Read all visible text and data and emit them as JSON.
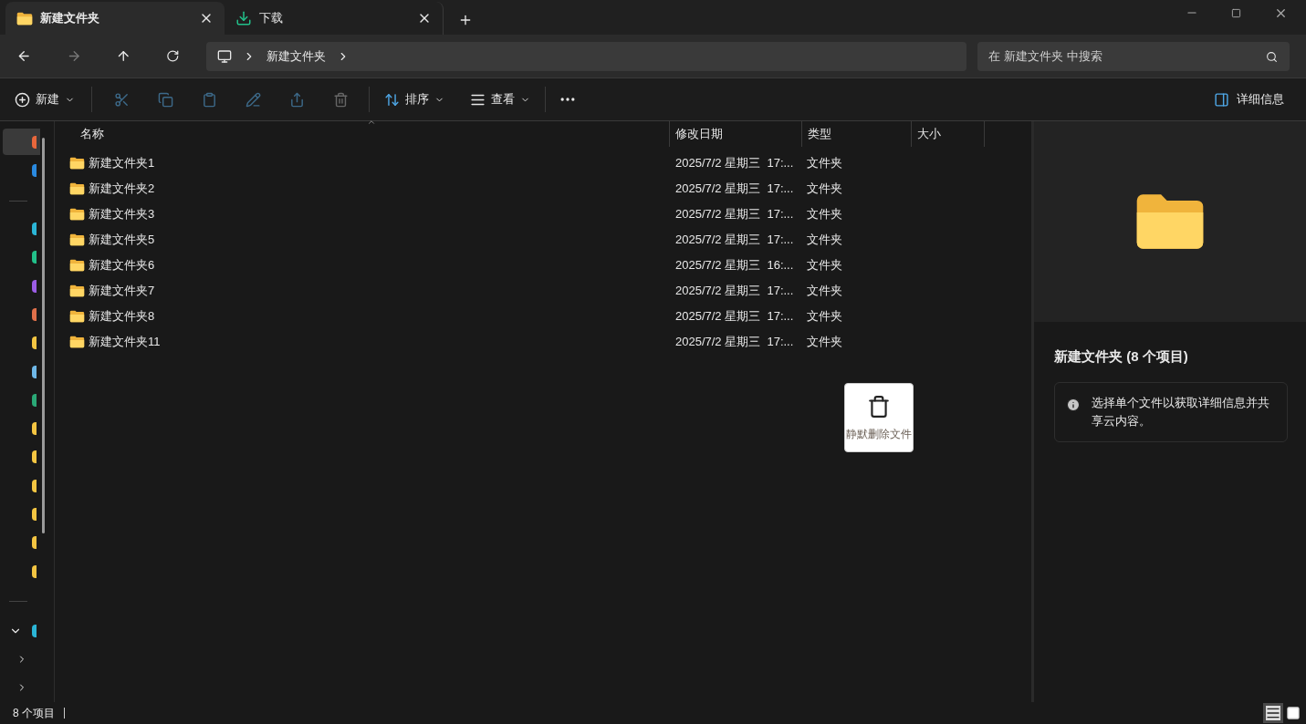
{
  "tabs": [
    {
      "label": "新建文件夹",
      "kind": "folder",
      "selected": true
    },
    {
      "label": "下载",
      "kind": "download",
      "selected": false
    }
  ],
  "address": {
    "crumbs": [
      "新建文件夹"
    ]
  },
  "search": {
    "placeholder": "在 新建文件夹 中搜索"
  },
  "toolbar": {
    "new_label": "新建",
    "sort_label": "排序",
    "view_label": "查看",
    "details_label": "详细信息"
  },
  "sidebar": {
    "items": [
      {
        "color": "#e8673c",
        "selected": true
      },
      {
        "color": "#2a8ae0",
        "selected": false
      },
      {
        "color": "#2bb5d6",
        "selected": false,
        "divider_before": true
      },
      {
        "color": "#22c08a",
        "selected": false
      },
      {
        "color": "#9b5de5",
        "selected": false
      },
      {
        "color": "#e0704a",
        "selected": false
      },
      {
        "color": "#f4c542",
        "selected": false
      },
      {
        "color": "#6fb8e8",
        "selected": false
      },
      {
        "color": "#2aa876",
        "selected": false
      },
      {
        "color": "#f4c542",
        "selected": false
      },
      {
        "color": "#f4c542",
        "selected": false
      },
      {
        "color": "#f4c542",
        "selected": false
      },
      {
        "color": "#f4c542",
        "selected": false
      },
      {
        "color": "#f4c542",
        "selected": false
      },
      {
        "color": "#f4c542",
        "selected": false
      }
    ],
    "tree": [
      {
        "expanded": true,
        "color": "#2bb5d6"
      },
      {
        "expanded": false
      },
      {
        "expanded": false
      }
    ]
  },
  "table": {
    "columns": [
      "名称",
      "修改日期",
      "类型",
      "大小"
    ],
    "rows": [
      {
        "name": "新建文件夹1",
        "modified": "2025/7/2 星期三  17:...",
        "type": "文件夹"
      },
      {
        "name": "新建文件夹2",
        "modified": "2025/7/2 星期三  17:...",
        "type": "文件夹"
      },
      {
        "name": "新建文件夹3",
        "modified": "2025/7/2 星期三  17:...",
        "type": "文件夹"
      },
      {
        "name": "新建文件夹5",
        "modified": "2025/7/2 星期三  17:...",
        "type": "文件夹"
      },
      {
        "name": "新建文件夹6",
        "modified": "2025/7/2 星期三  16:...",
        "type": "文件夹"
      },
      {
        "name": "新建文件夹7",
        "modified": "2025/7/2 星期三  17:...",
        "type": "文件夹"
      },
      {
        "name": "新建文件夹8",
        "modified": "2025/7/2 星期三  17:...",
        "type": "文件夹"
      },
      {
        "name": "新建文件夹11",
        "modified": "2025/7/2 星期三  17:...",
        "type": "文件夹"
      }
    ]
  },
  "tooltip": {
    "label": "静默删除文件"
  },
  "details": {
    "title": "新建文件夹 (8 个项目)",
    "info": "选择单个文件以获取详细信息并共享云内容。"
  },
  "status_bar": {
    "count": "8 个项目"
  },
  "view_modes": [
    {
      "kind": "details",
      "selected": true
    },
    {
      "kind": "tiles",
      "selected": false
    }
  ]
}
